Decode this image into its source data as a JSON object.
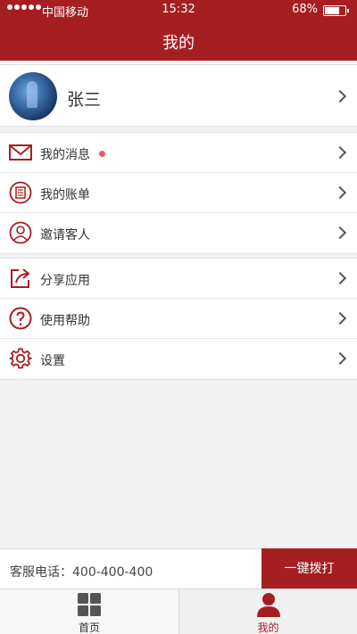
{
  "status_bar": {
    "carrier": "中国移动",
    "time": "15:32",
    "battery": "68%"
  },
  "header": {
    "title": "我的"
  },
  "profile": {
    "name": "张三"
  },
  "menu_group_1": [
    {
      "label": "我的消息",
      "icon": "mail-icon",
      "has_badge": true
    },
    {
      "label": "我的账单",
      "icon": "bill-icon"
    },
    {
      "label": "邀请客人",
      "icon": "user-icon"
    }
  ],
  "menu_group_2": [
    {
      "label": "分享应用",
      "icon": "share-icon"
    },
    {
      "label": "使用帮助",
      "icon": "help-icon"
    },
    {
      "label": "设置",
      "icon": "gear-icon"
    }
  ],
  "service": {
    "phone_text": "客服电话：400-400-400",
    "call_button": "一键拨打"
  },
  "tabbar": {
    "home_label": "首页",
    "me_label": "我的"
  },
  "colors": {
    "brand": "#a51e22",
    "badge": "#e35d5d"
  }
}
